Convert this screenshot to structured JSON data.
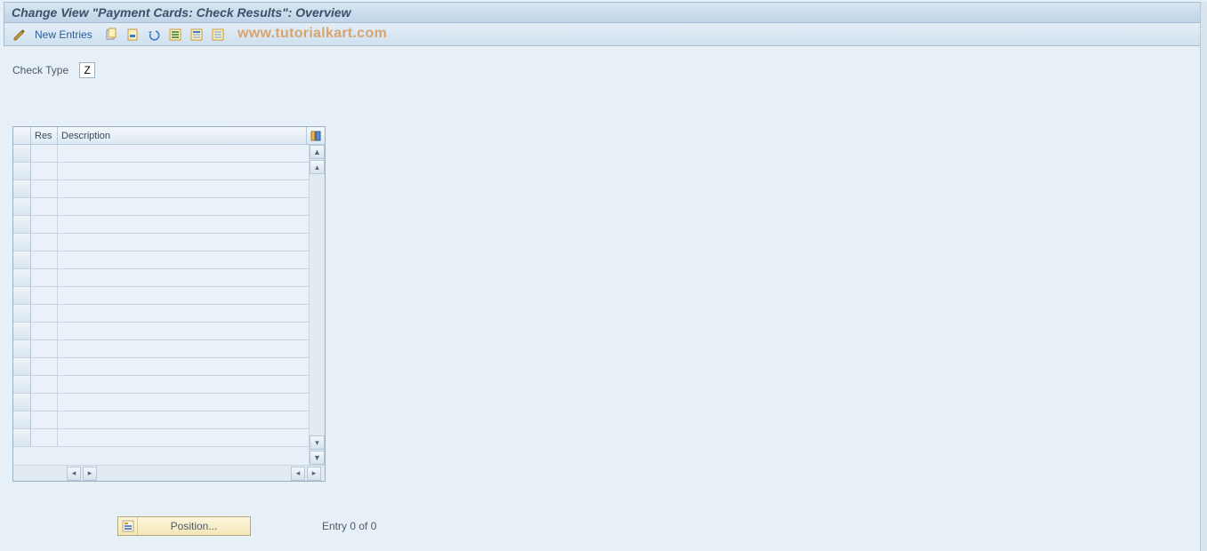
{
  "title": "Change View \"Payment Cards: Check Results\": Overview",
  "toolbar": {
    "new_entries": "New Entries"
  },
  "watermark": "www.tutorialkart.com",
  "fields": {
    "check_type_label": "Check Type",
    "check_type_value": "Z"
  },
  "table": {
    "headers": {
      "res": "Res",
      "description": "Description"
    },
    "rows": [
      {
        "res": "",
        "desc": ""
      },
      {
        "res": "",
        "desc": ""
      },
      {
        "res": "",
        "desc": ""
      },
      {
        "res": "",
        "desc": ""
      },
      {
        "res": "",
        "desc": ""
      },
      {
        "res": "",
        "desc": ""
      },
      {
        "res": "",
        "desc": ""
      },
      {
        "res": "",
        "desc": ""
      },
      {
        "res": "",
        "desc": ""
      },
      {
        "res": "",
        "desc": ""
      },
      {
        "res": "",
        "desc": ""
      },
      {
        "res": "",
        "desc": ""
      },
      {
        "res": "",
        "desc": ""
      },
      {
        "res": "",
        "desc": ""
      },
      {
        "res": "",
        "desc": ""
      },
      {
        "res": "",
        "desc": ""
      },
      {
        "res": "",
        "desc": ""
      }
    ]
  },
  "footer": {
    "position_label": "Position...",
    "entry_text": "Entry 0 of 0"
  }
}
